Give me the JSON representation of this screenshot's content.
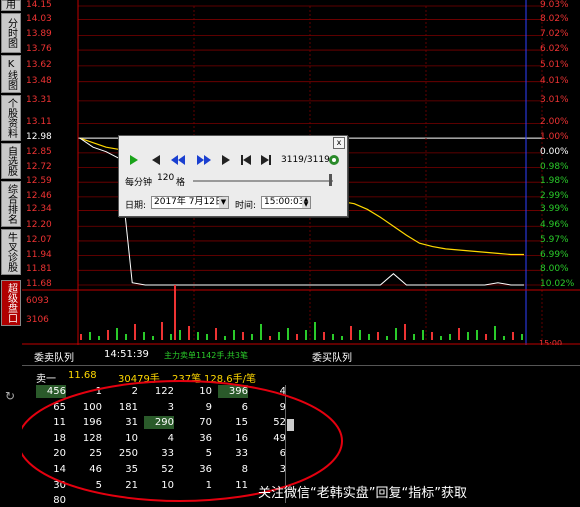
{
  "tabs": [
    {
      "label": "用"
    },
    {
      "label": "分时图"
    },
    {
      "label": "K线图"
    },
    {
      "label": "个股资料"
    },
    {
      "label": "自选股"
    },
    {
      "label": "综合排名"
    },
    {
      "label": "牛叉诊股"
    },
    {
      "label": "超级盘口"
    }
  ],
  "left_prices": [
    "14.15",
    "14.03",
    "13.89",
    "13.76",
    "13.62",
    "13.48",
    "13.31",
    "13.11",
    "12.98",
    "12.85",
    "12.72",
    "12.59",
    "12.46",
    "12.34",
    "12.20",
    "12.07",
    "11.94",
    "11.81",
    "11.68"
  ],
  "right_percents": [
    "9.03%",
    "8.02%",
    "7.02%",
    "6.02%",
    "5.01%",
    "4.01%",
    "3.01%",
    "2.00%",
    "1.00%",
    "0.00%",
    "0.98%",
    "1.98%",
    "2.99%",
    "3.99%",
    "4.96%",
    "5.97%",
    "6.99%",
    "8.00%",
    "10.02%"
  ],
  "volume_labels": [
    "6093",
    "3106"
  ],
  "right_time": "15:00",
  "colors": {
    "up": "#ff3b3b",
    "price_line": "#ffffff",
    "avg_line": "#ffd800",
    "grid": "#7a0000",
    "border": "#c00000",
    "blue_line": "#3040ff"
  },
  "chart_data": {
    "type": "line",
    "title": "",
    "y_left_ticks": [
      14.15,
      14.03,
      13.89,
      13.76,
      13.62,
      13.48,
      13.31,
      13.11,
      12.98,
      12.85,
      12.72,
      12.59,
      12.46,
      12.34,
      12.2,
      12.07,
      11.94,
      11.81,
      11.68
    ],
    "ylim": [
      11.68,
      14.15
    ],
    "prev_close": 12.98,
    "series": [
      {
        "values": [
          12.98,
          12.94,
          12.9,
          12.88,
          12.86,
          12.87,
          12.85,
          12.8,
          12.76,
          12.72,
          12.68,
          12.62,
          12.58,
          12.55,
          12.53,
          12.5,
          12.48,
          12.46,
          12.44,
          12.43,
          12.42,
          12.4,
          12.35,
          12.28,
          12.2,
          12.12,
          12.05,
          12.02,
          12.0,
          11.99,
          11.98,
          11.97,
          11.96,
          11.95,
          11.95
        ]
      },
      {
        "values": [
          12.98,
          12.9,
          12.86,
          12.8,
          11.7,
          11.68,
          11.68,
          11.68,
          11.68,
          11.68,
          11.68,
          11.68,
          11.68,
          11.68,
          11.68,
          11.68,
          11.68,
          11.68,
          11.68,
          11.68,
          11.68,
          11.68,
          11.68,
          11.68,
          11.78,
          11.68,
          11.68,
          11.68,
          11.68,
          11.68,
          11.68,
          11.68,
          11.7,
          11.68,
          11.68
        ]
      }
    ],
    "grid": true
  },
  "dialog": {
    "counter": "3119/3119",
    "per_minute_label": "每分钟",
    "per_minute_value": "120",
    "unit_label": "格",
    "date_label": "日期:",
    "date_value": "2017年 7月12日",
    "time_label": "时间:",
    "time_value": "15:00:03",
    "close": "x"
  },
  "panel": {
    "title_left": "委卖队列",
    "time": "14:51:39",
    "note": "主力卖单1142手,共3笔",
    "title_right": "委买队列",
    "sell1_label": "卖一",
    "sell1_price": "11.68",
    "sell1_volume": "30479手",
    "sell1_count": "237笔",
    "sell1_avg": "128.6手/笔",
    "queue": [
      [
        "456",
        "1",
        "2",
        "122",
        "10",
        "396",
        "4"
      ],
      [
        "65",
        "100",
        "181",
        "3",
        "9",
        "6",
        "9"
      ],
      [
        "11",
        "196",
        "31",
        "290",
        "70",
        "15",
        "52"
      ],
      [
        "18",
        "128",
        "10",
        "4",
        "36",
        "16",
        "49"
      ],
      [
        "20",
        "25",
        "250",
        "33",
        "5",
        "33",
        "6"
      ],
      [
        "14",
        "46",
        "35",
        "52",
        "36",
        "8",
        "3"
      ],
      [
        "30",
        "5",
        "21",
        "10",
        "1",
        "11",
        ""
      ],
      [
        "80",
        "",
        "",
        "",
        "",
        "",
        ""
      ]
    ]
  },
  "watermark": "关注微信“老韩实盘”回复“指标”获取"
}
